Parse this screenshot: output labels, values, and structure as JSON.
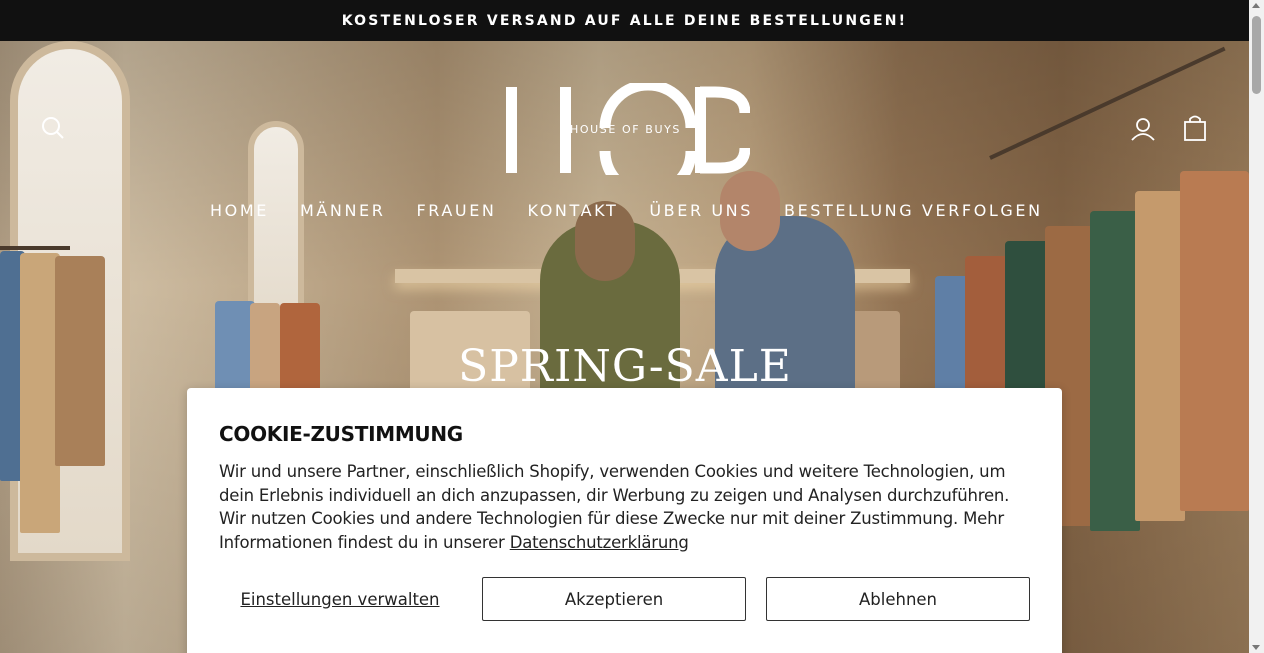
{
  "announcement": {
    "text": "KOSTENLOSER VERSAND AUF ALLE DEINE BESTELLUNGEN!"
  },
  "header": {
    "logo_letters": "HOB",
    "logo_subtitle": "HOUSE OF BUYS",
    "icons": {
      "search": "search-icon",
      "account": "user-icon",
      "cart": "shopping-bag-icon"
    }
  },
  "nav": {
    "items": [
      {
        "label": "HOME"
      },
      {
        "label": "MÄNNER"
      },
      {
        "label": "FRAUEN"
      },
      {
        "label": "KONTAKT"
      },
      {
        "label": "ÜBER UNS"
      },
      {
        "label": "BESTELLUNG VERFOLGEN"
      }
    ]
  },
  "hero": {
    "title": "SPRING-SALE"
  },
  "cookie": {
    "title": "COOKIE-ZUSTIMMUNG",
    "text": "Wir und unsere Partner, einschließlich Shopify, verwenden Cookies und weitere Technologien, um dein Erlebnis individuell an dich anzupassen, dir Werbung zu zeigen und Analysen durchzuführen. Wir nutzen Cookies und andere Technologien für diese Zwecke nur mit deiner Zustimmung. Mehr Informationen findest du in unserer ",
    "privacy_link": "Datenschutzerklärung",
    "manage_label": "Einstellungen verwalten",
    "accept_label": "Akzeptieren",
    "decline_label": "Ablehnen"
  },
  "colors": {
    "announcement_bg": "#111111",
    "text_on_hero": "#ffffff",
    "button_border": "#333333"
  }
}
